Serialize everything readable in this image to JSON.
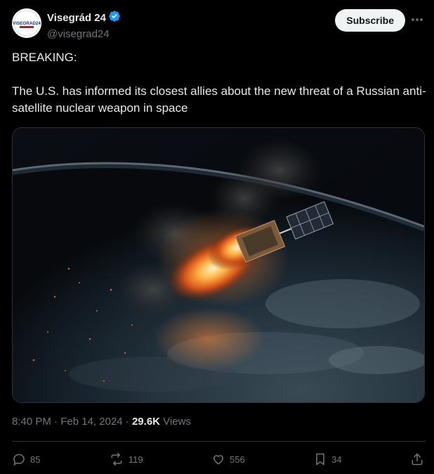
{
  "author": {
    "display_name": "Visegrád 24",
    "handle": "@visegrad24",
    "avatar_text": "VISEGRAD24",
    "verified_icon": "verified-badge-icon"
  },
  "subscribe_label": "Subscribe",
  "more_icon": "more-icon",
  "post": {
    "line1": "BREAKING:",
    "line2": "The U.S. has informed its closest allies about the new threat of a Russian anti-satellite nuclear weapon in space"
  },
  "meta": {
    "time": "8:40 PM",
    "sep1": " · ",
    "date": "Feb 14, 2024",
    "sep2": " · ",
    "views_count": "29.6K",
    "views_label": " Views"
  },
  "actions": {
    "replies": "85",
    "reposts": "119",
    "likes": "556",
    "bookmarks": "34"
  },
  "colors": {
    "background": "#000000",
    "text": "#e7e9ea",
    "muted": "#71767b",
    "verified": "#1d9bf0",
    "divider": "#2f3336"
  }
}
